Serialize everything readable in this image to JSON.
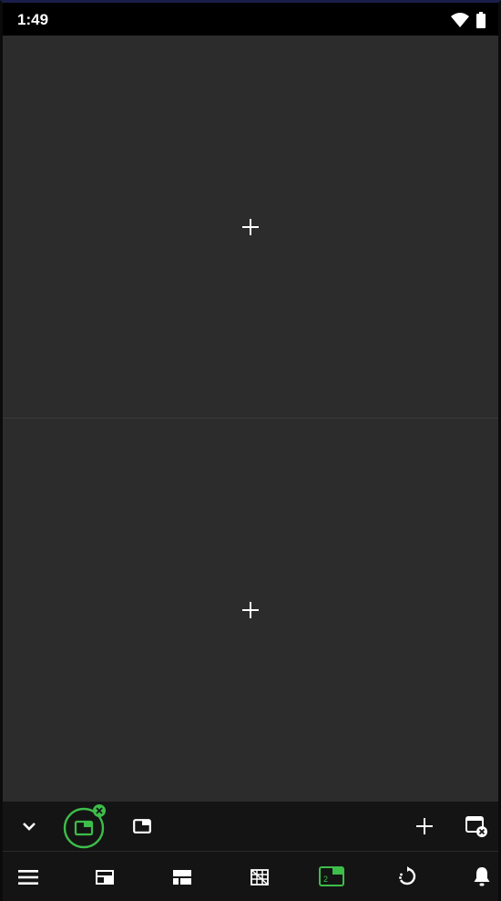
{
  "status_bar": {
    "time": "1:49",
    "icons": [
      "wifi-icon",
      "battery-icon"
    ]
  },
  "grid": {
    "cells": [
      {
        "add_icon": "plus-icon"
      },
      {
        "add_icon": "plus-icon"
      }
    ]
  },
  "toolbar": {
    "left_icons": [
      "chevron-down-icon",
      "single-view-active-icon",
      "single-view-icon"
    ],
    "right_icons": [
      "plus-icon",
      "close-view-icon"
    ]
  },
  "navbar": {
    "icons": [
      "menu-icon",
      "layout-split-icon",
      "layout-grid-icon",
      "layout-multi-icon",
      "layout-2-active-icon",
      "rotate-icon",
      "bell-icon"
    ]
  },
  "colors": {
    "background": "#2c2c2c",
    "bar": "#141414",
    "accent": "#3dbd4a",
    "icon": "#ffffff"
  }
}
